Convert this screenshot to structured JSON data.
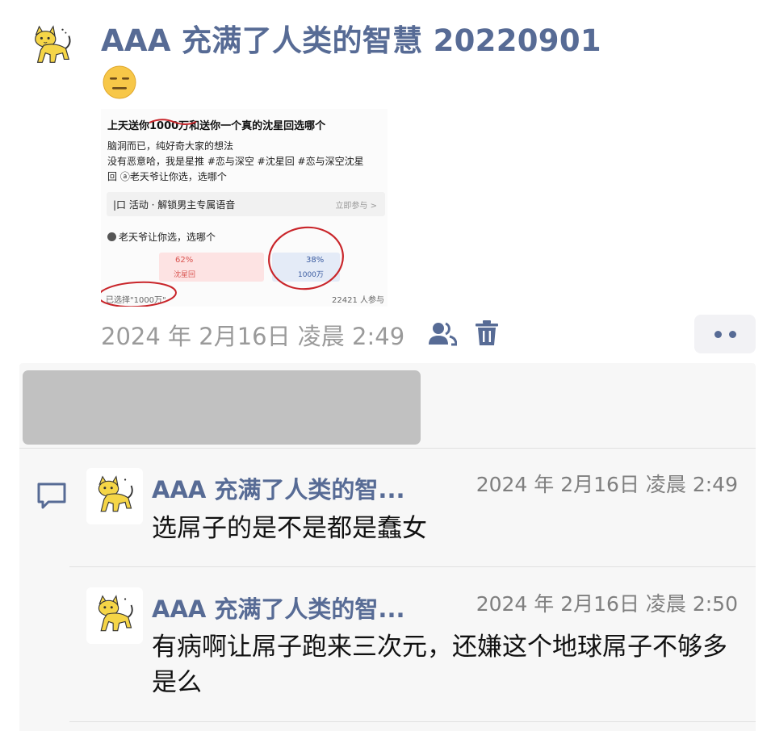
{
  "post": {
    "author": "AAA 充满了人类的智慧 20220901",
    "emoji": "😑",
    "timestamp": "2024 年 2月16日 凌晨 2:49",
    "image": {
      "title": "上天送你1000万和送你一个真的沈星回选哪个",
      "lines": [
        "脑洞而已，纯好奇大家的想法",
        "没有恶意哈，我是星推 #恋与深空  #沈星回  #恋与深空沈星",
        "回 ⓐ老天爷让你选，选哪个"
      ],
      "activity_label": "|口 活动 · 解锁男主专属语音",
      "activity_link": "立即参与 >",
      "question": "老天爷让你选，选哪个",
      "option_a": {
        "percent": "62%",
        "label": "沈星回",
        "color": "#d9534f"
      },
      "option_b": {
        "percent": "38%",
        "label": "1000万",
        "color": "#3a5ba0"
      },
      "selected": "已选择\"1000万\"",
      "participants": "22421 人参与"
    }
  },
  "icons": {
    "avatar": "cat-icon",
    "friends": "friends-icon",
    "delete": "trash-icon",
    "comment": "comment-icon",
    "more": "more-dots-icon"
  },
  "colors": {
    "link": "#576b95",
    "timestamp": "#9a9a9a",
    "comment_bg": "#f7f7f7"
  },
  "comments": [
    {
      "author": "AAA 充满了人类的智...",
      "time": "2024 年 2月16日 凌晨 2:49",
      "text": "选屌子的是不是都是蠢女"
    },
    {
      "author": "AAA 充满了人类的智...",
      "time": "2024 年 2月16日 凌晨 2:50",
      "text": "有病啊让屌子跑来三次元，还嫌这个地球屌子不够多是么"
    }
  ]
}
